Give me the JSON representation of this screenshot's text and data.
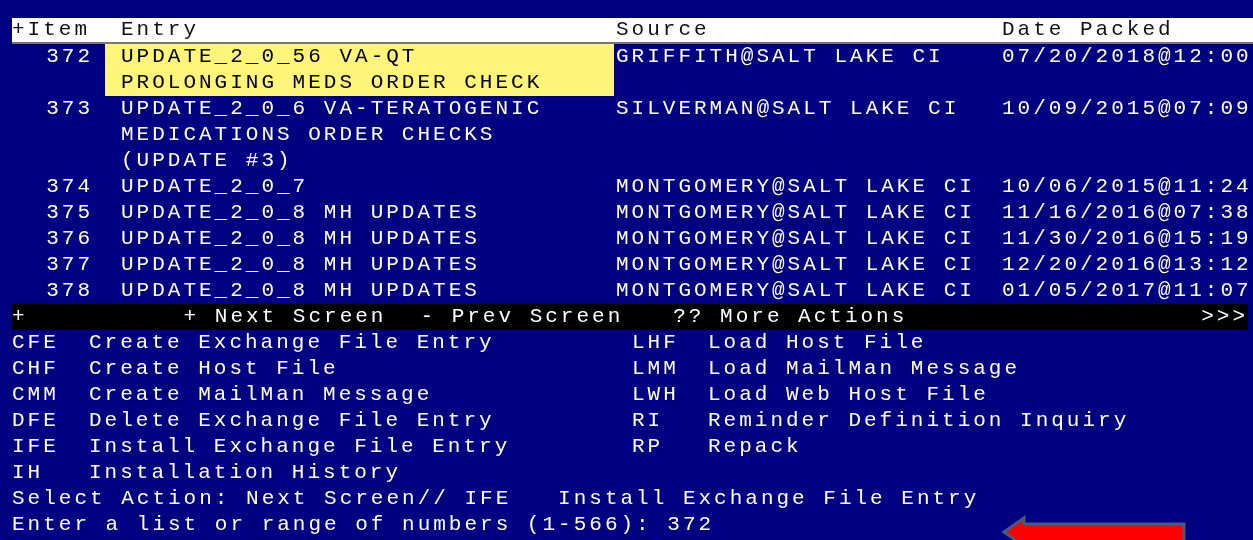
{
  "header": {
    "columns": [
      "+Item",
      "Entry",
      "Source",
      "Date Packed"
    ]
  },
  "rows": [
    {
      "item": "372",
      "entry_lines": [
        "UPDATE_2_0_56 VA-QT",
        "PROLONGING MEDS ORDER CHECK"
      ],
      "source": "GRIFFITH@SALT LAKE CI",
      "date": "07/20/2018@12:00",
      "selected": true
    },
    {
      "item": "373",
      "entry_lines": [
        "UPDATE_2_0_6 VA-TERATOGENIC",
        "MEDICATIONS ORDER CHECKS",
        "(UPDATE #3)"
      ],
      "source": "SILVERMAN@SALT LAKE CI",
      "date": "10/09/2015@07:09",
      "selected": false
    },
    {
      "item": "374",
      "entry_lines": [
        "UPDATE_2_0_7"
      ],
      "source": "MONTGOMERY@SALT LAKE CI",
      "date": "10/06/2015@11:24",
      "selected": false
    },
    {
      "item": "375",
      "entry_lines": [
        "UPDATE_2_0_8 MH UPDATES"
      ],
      "source": "MONTGOMERY@SALT LAKE CI",
      "date": "11/16/2016@07:38",
      "selected": false
    },
    {
      "item": "376",
      "entry_lines": [
        "UPDATE_2_0_8 MH UPDATES"
      ],
      "source": "MONTGOMERY@SALT LAKE CI",
      "date": "11/30/2016@15:19",
      "selected": false
    },
    {
      "item": "377",
      "entry_lines": [
        "UPDATE_2_0_8 MH UPDATES"
      ],
      "source": "MONTGOMERY@SALT LAKE CI",
      "date": "12/20/2016@13:12",
      "selected": false
    },
    {
      "item": "378",
      "entry_lines": [
        "UPDATE_2_0_8 MH UPDATES"
      ],
      "source": "MONTGOMERY@SALT LAKE CI",
      "date": "01/05/2017@11:07",
      "selected": false
    }
  ],
  "action_bar": {
    "marker": "+",
    "items": [
      "+ Next Screen",
      "- Prev Screen",
      "?? More Actions"
    ],
    "more": ">>>"
  },
  "actions_left": [
    {
      "code": "CFE",
      "label": "Create Exchange File Entry"
    },
    {
      "code": "CHF",
      "label": "Create Host File"
    },
    {
      "code": "CMM",
      "label": "Create MailMan Message"
    },
    {
      "code": "DFE",
      "label": "Delete Exchange File Entry"
    },
    {
      "code": "IFE",
      "label": "Install Exchange File Entry"
    },
    {
      "code": "IH",
      "label": "Installation History"
    }
  ],
  "actions_right": [
    {
      "code": "LHF",
      "label": "Load Host File"
    },
    {
      "code": "LMM",
      "label": "Load MailMan Message"
    },
    {
      "code": "LWH",
      "label": "Load Web Host File"
    },
    {
      "code": "RI",
      "label": "Reminder Definition Inquiry"
    },
    {
      "code": "RP",
      "label": "Repack"
    }
  ],
  "prompts": [
    "Select Action: Next Screen// IFE   Install Exchange File Entry",
    "Enter a list or range of numbers (1-566): 372"
  ]
}
